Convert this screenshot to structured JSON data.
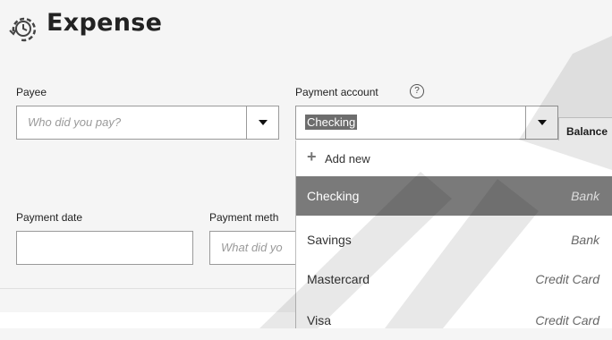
{
  "header": {
    "title": "Expense",
    "icon": "receipt-clock-icon"
  },
  "payee": {
    "label": "Payee",
    "placeholder": "Who did you pay?"
  },
  "payment_account": {
    "label": "Payment account",
    "help": "?",
    "value": "Checking",
    "balance_label": "Balance"
  },
  "payment_date": {
    "label": "Payment date",
    "value": ""
  },
  "payment_method": {
    "label": "Payment meth",
    "placeholder": "What did yo"
  },
  "account_dropdown": {
    "add_new": "Add new",
    "items": [
      {
        "name": "Checking",
        "type": "Bank",
        "selected": true
      },
      {
        "name": "Savings",
        "type": "Bank",
        "selected": false
      },
      {
        "name": "Mastercard",
        "type": "Credit Card",
        "selected": false
      },
      {
        "name": "Visa",
        "type": "Credit Card",
        "selected": false
      }
    ]
  },
  "colors": {
    "highlight": "#7a7a7a",
    "background": "#f5f5f5"
  }
}
